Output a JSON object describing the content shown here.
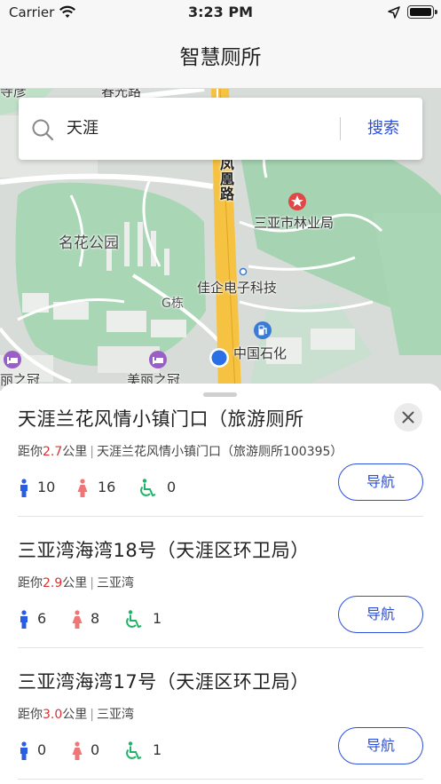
{
  "status_bar": {
    "carrier": "Carrier",
    "time": "3:23 PM"
  },
  "nav": {
    "title": "智慧厕所"
  },
  "search": {
    "query": "天涯",
    "button_label": "搜索"
  },
  "map": {
    "labels": {
      "road": "凤凰路",
      "park": "名花公园",
      "bureau": "三亚市林业局",
      "tech": "佳企电子科技",
      "building": "G栋",
      "gas": "中国石化",
      "hotel": "美丽之冠",
      "hotel_left": "丽之冠",
      "top_road": "春光路",
      "top_left": "寺彦"
    }
  },
  "colors": {
    "accent": "#2b4fe0",
    "distance": "#e03030",
    "male": "#2b5de0",
    "female": "#f07575",
    "accessible": "#1fb36a"
  },
  "list": {
    "nav_label": "导航",
    "distance_prefix": "距你",
    "distance_unit": "公里",
    "items": [
      {
        "name": "天涯兰花风情小镇门口（旅游厕所",
        "distance": "2.7",
        "address": "天涯兰花风情小镇门口（旅游厕所100395）",
        "male": "10",
        "female": "16",
        "accessible": "0"
      },
      {
        "name": "三亚湾海湾18号（天涯区环卫局）",
        "distance": "2.9",
        "address": "三亚湾",
        "male": "6",
        "female": "8",
        "accessible": "1"
      },
      {
        "name": "三亚湾海湾17号（天涯区环卫局）",
        "distance": "3.0",
        "address": "三亚湾",
        "male": "0",
        "female": "0",
        "accessible": "1"
      }
    ]
  }
}
